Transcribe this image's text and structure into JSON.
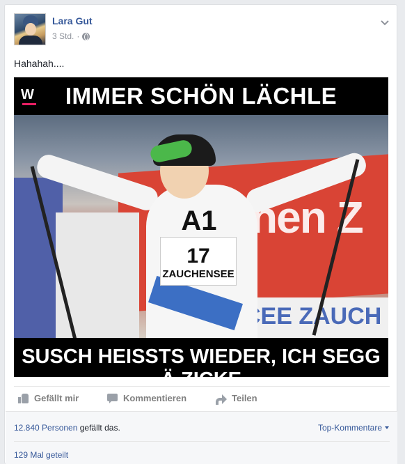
{
  "post": {
    "author": "Lara Gut",
    "timestamp": "3 Std.",
    "separator": "·",
    "privacy_icon": "globe-icon",
    "text": "Hahahah....",
    "options_icon": "chevron-down-icon"
  },
  "image": {
    "logo_letter": "W",
    "top_caption": "IMMER SCHÖN LÄCHLE",
    "bottom_caption": "SUSCH HEISSTS WIEDER, ICH SEGG Ä ZICKE",
    "bib_sponsor": "A1",
    "bib_number": "17",
    "bib_town": "ZAUCHENSEE",
    "banner_text": "nen Z",
    "banner_low_text": "CEE ZAUCH"
  },
  "actions": {
    "like_label": "Gefällt mir",
    "comment_label": "Kommentieren",
    "share_label": "Teilen"
  },
  "footer": {
    "likes_count": "12.840 Personen",
    "likes_suffix": " gefällt das.",
    "top_comments": "Top-Kommentare",
    "shares": "129 Mal geteilt"
  },
  "colors": {
    "link": "#365899",
    "muted": "#90949c",
    "background": "#e9ebee"
  }
}
